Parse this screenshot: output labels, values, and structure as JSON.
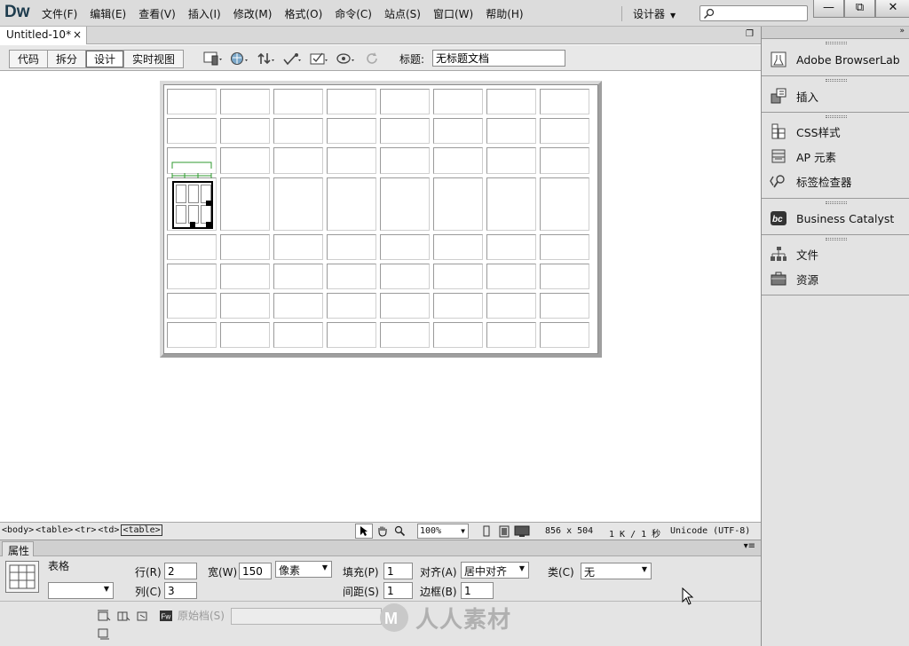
{
  "app": {
    "logo": "Dw"
  },
  "menu": [
    "文件(F)",
    "编辑(E)",
    "查看(V)",
    "插入(I)",
    "修改(M)",
    "格式(O)",
    "命令(C)",
    "站点(S)",
    "窗口(W)",
    "帮助(H)"
  ],
  "workspace": {
    "label": "设计器"
  },
  "window_buttons": {
    "minimize": "—",
    "restore": "⧉",
    "close": "✕"
  },
  "document_tab": {
    "name": "Untitled-10*",
    "close": "×"
  },
  "doc_toolbar": {
    "view_buttons": [
      "代码",
      "拆分",
      "设计",
      "实时视图"
    ],
    "active_view": "设计",
    "title_label": "标题:",
    "title_value": "无标题文档"
  },
  "status": {
    "tag_selector": [
      "<body>",
      "<table>",
      "<tr>",
      "<td>",
      "<table>"
    ],
    "zoom": "100%",
    "dimensions": "856 x 504",
    "size": "1 K / 1 秒",
    "encoding": "Unicode (UTF-8)"
  },
  "properties": {
    "tab": "属性",
    "element_label": "表格",
    "rows_label": "行(R)",
    "rows_value": "2",
    "cols_label": "列(C)",
    "cols_value": "3",
    "width_label": "宽(W)",
    "width_value": "150",
    "width_unit": "像素",
    "padding_label": "填充(P)",
    "padding_value": "1",
    "spacing_label": "间距(S)",
    "spacing_value": "1",
    "align_label": "对齐(A)",
    "align_value": "居中对齐",
    "border_label": "边框(B)",
    "border_value": "1",
    "class_label": "类(C)",
    "class_value": "无",
    "source_label": "原始档(S)",
    "fw_label": "Fw"
  },
  "watermark": {
    "text": "人人素材"
  },
  "dock": {
    "items": [
      {
        "label": "Adobe BrowserLab",
        "icon": "browserlab-icon"
      },
      {
        "label": "插入",
        "icon": "insert-icon"
      },
      {
        "label": "CSS样式",
        "icon": "css-styles-icon"
      },
      {
        "label": "AP 元素",
        "icon": "ap-elements-icon"
      },
      {
        "label": "标签检查器",
        "icon": "tag-inspector-icon"
      },
      {
        "label": "Business Catalyst",
        "icon": "business-catalyst-icon"
      },
      {
        "label": "文件",
        "icon": "files-icon"
      },
      {
        "label": "资源",
        "icon": "assets-icon"
      }
    ]
  },
  "design_table": {
    "rows": 8,
    "cols": 8
  },
  "nested_table": {
    "rows": 2,
    "cols": 3
  }
}
